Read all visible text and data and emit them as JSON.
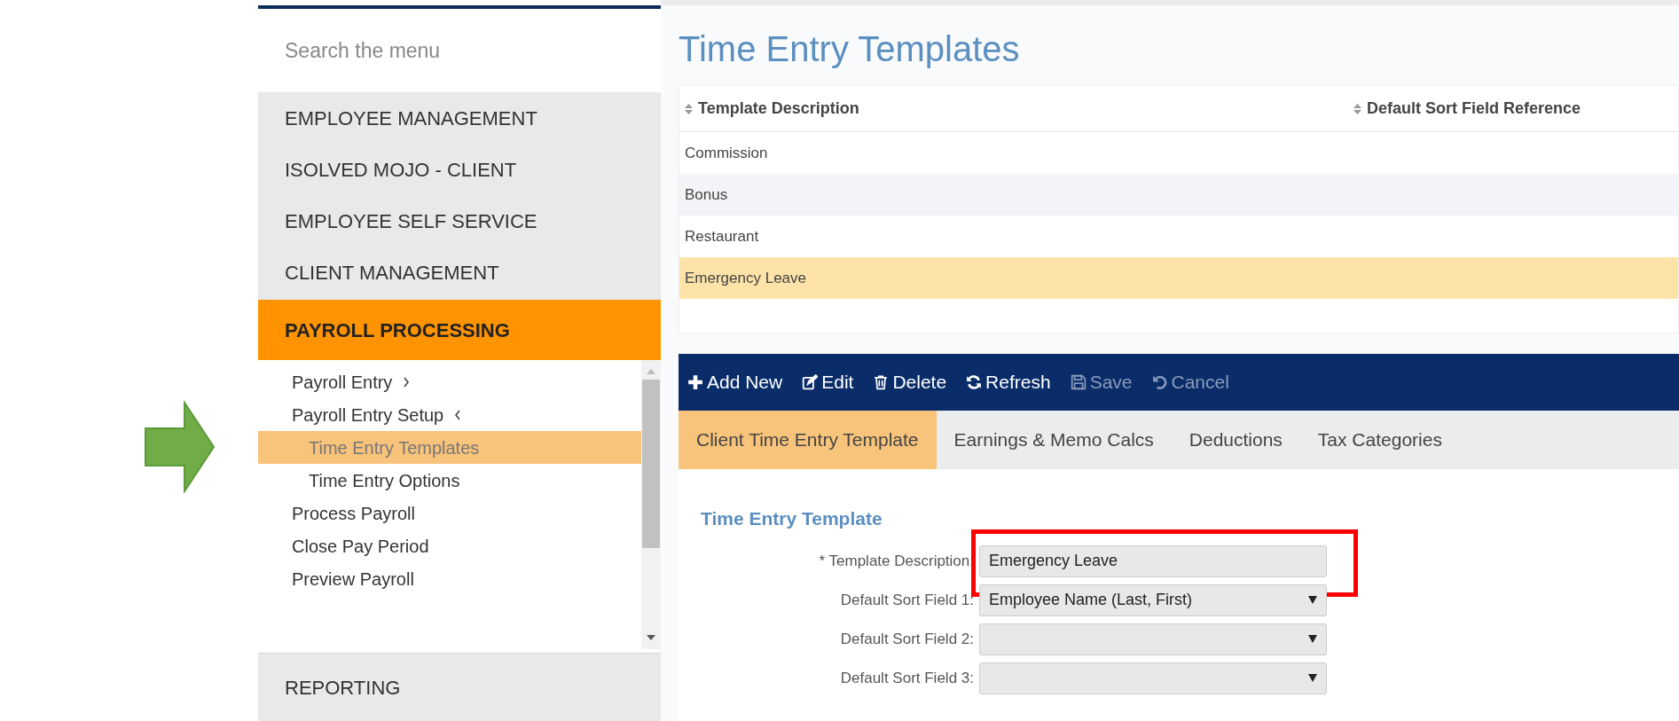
{
  "sidebar": {
    "search": {
      "placeholder": "Search the menu"
    },
    "sections": [
      {
        "label": "EMPLOYEE MANAGEMENT",
        "selected": false
      },
      {
        "label": "ISOLVED MOJO - CLIENT",
        "selected": false
      },
      {
        "label": "EMPLOYEE SELF SERVICE",
        "selected": false
      },
      {
        "label": "CLIENT MANAGEMENT",
        "selected": false
      },
      {
        "label": "PAYROLL PROCESSING",
        "selected": true
      }
    ],
    "submenu": [
      {
        "label": "Payroll Entry",
        "expanded": false,
        "selected": false
      },
      {
        "label": "Payroll Entry Setup",
        "expanded": true,
        "selected": false,
        "children": [
          {
            "label": "Time Entry Templates",
            "selected": true
          },
          {
            "label": "Time Entry Options",
            "selected": false
          }
        ]
      },
      {
        "label": "Process Payroll",
        "selected": false
      },
      {
        "label": "Close Pay Period",
        "selected": false
      },
      {
        "label": "Preview Payroll",
        "selected": false
      }
    ],
    "bottom_section": {
      "label": "REPORTING"
    }
  },
  "page": {
    "title": "Time Entry Templates"
  },
  "table": {
    "columns": [
      "Template Description",
      "Default Sort Field Reference"
    ],
    "rows": [
      {
        "cells": [
          "Commission",
          ""
        ],
        "selected": false
      },
      {
        "cells": [
          "Bonus",
          ""
        ],
        "selected": false
      },
      {
        "cells": [
          "Restaurant",
          ""
        ],
        "selected": false
      },
      {
        "cells": [
          "Emergency Leave",
          ""
        ],
        "selected": true
      }
    ]
  },
  "toolbar": [
    {
      "kind": "add",
      "label": "Add New",
      "disabled": false
    },
    {
      "kind": "edit",
      "label": "Edit",
      "disabled": false
    },
    {
      "kind": "delete",
      "label": "Delete",
      "disabled": false
    },
    {
      "kind": "refresh",
      "label": "Refresh",
      "disabled": false
    },
    {
      "kind": "save",
      "label": "Save",
      "disabled": true
    },
    {
      "kind": "cancel",
      "label": "Cancel",
      "disabled": true
    }
  ],
  "tabs": [
    {
      "label": "Client Time Entry Template",
      "selected": true
    },
    {
      "label": "Earnings & Memo Calcs",
      "selected": false
    },
    {
      "label": "Deductions",
      "selected": false
    },
    {
      "label": "Tax Categories",
      "selected": false
    }
  ],
  "form": {
    "title": "Time Entry Template",
    "fields": [
      {
        "kind": "text",
        "label": "* Template Description:",
        "value": "Emergency Leave",
        "highlighted": true
      },
      {
        "kind": "select",
        "label": "Default Sort Field 1:",
        "value": "Employee Name (Last, First)",
        "highlighted": false
      },
      {
        "kind": "select",
        "label": "Default Sort Field 2:",
        "highlighted": false
      },
      {
        "kind": "select",
        "label": "Default Sort Field 3:",
        "highlighted": false
      }
    ]
  }
}
